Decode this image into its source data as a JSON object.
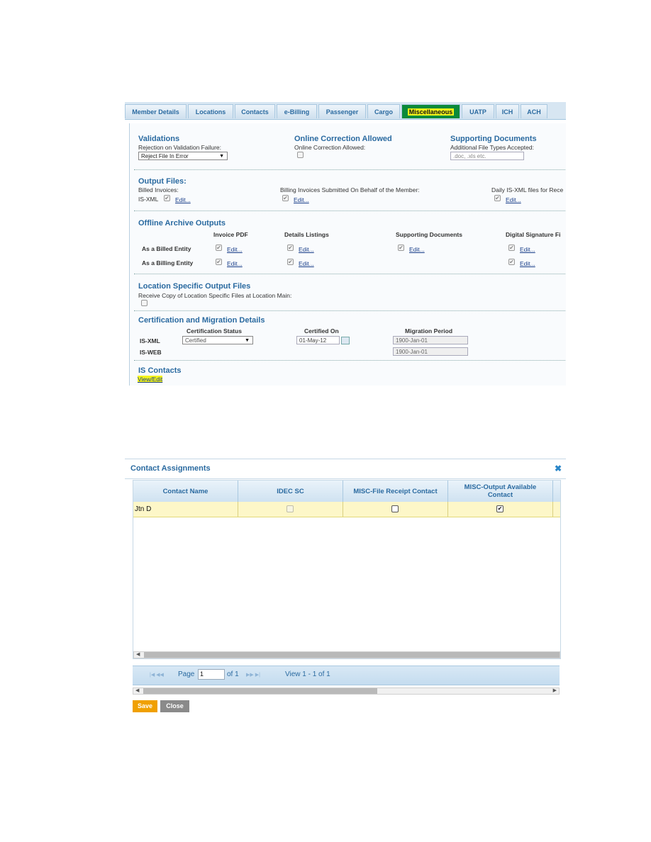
{
  "tabs": [
    "Member Details",
    "Locations",
    "Contacts",
    "e-Billing",
    "Passenger",
    "Cargo",
    "Miscellaneous",
    "UATP",
    "ICH",
    "ACH"
  ],
  "validations": {
    "title": "Validations",
    "rejection_label": "Rejection on Validation Failure:",
    "rejection_value": "Reject File In Error",
    "online_title": "Online Correction Allowed",
    "online_label": "Online Correction Allowed:",
    "docs_title": "Supporting Documents",
    "docs_label": "Additional File Types Accepted:",
    "docs_placeholder": ".doc, .xls etc."
  },
  "output_files": {
    "title": "Output Files:",
    "billed_label": "Billed Invoices:",
    "isxml": "IS-XML",
    "behalf_label": "Billing Invoices Submitted On Behalf of the Member:",
    "daily_label": "Daily IS-XML files for Rece",
    "edit": "Edit..."
  },
  "offline": {
    "title": "Offline Archive Outputs",
    "columns": [
      "Invoice PDF",
      "Details Listings",
      "Supporting Documents",
      "Digital Signature Fi"
    ],
    "rows": [
      "As a Billed Entity",
      "As a Billing Entity"
    ],
    "edit": "Edit..."
  },
  "location": {
    "title": "Location Specific Output Files",
    "label": "Receive Copy of Location Specific Files at Location Main:"
  },
  "certification": {
    "title": "Certification and Migration Details",
    "col_status": "Certification Status",
    "col_on": "Certified On",
    "col_period": "Migration Period",
    "row1": "IS-XML",
    "row2": "IS-WEB",
    "status_value": "Certified",
    "certified_on": "01-May-12",
    "period1": "1900-Jan-01",
    "period2": "1900-Jan-01"
  },
  "is_contacts": {
    "title": "IS Contacts",
    "link": "View/Edit"
  },
  "dialog": {
    "title": "Contact Assignments",
    "columns": [
      "Contact Name",
      "IDEC SC",
      "MISC-File Receipt Contact",
      "MISC-Output Available Contact"
    ],
    "row": {
      "name": "Jtn D",
      "idec_sc": false,
      "file_receipt": false,
      "output_available": true
    },
    "pager": {
      "page_label": "Page",
      "page_value": "1",
      "of_label": "of 1",
      "view": "View 1 - 1 of 1"
    },
    "save": "Save",
    "close": "Close"
  },
  "colors": {
    "accent": "#2a6aa0",
    "highlight": "#f5f51a",
    "save": "#f0a000",
    "close": "#8a8a8a",
    "row": "#fdf7c8"
  }
}
